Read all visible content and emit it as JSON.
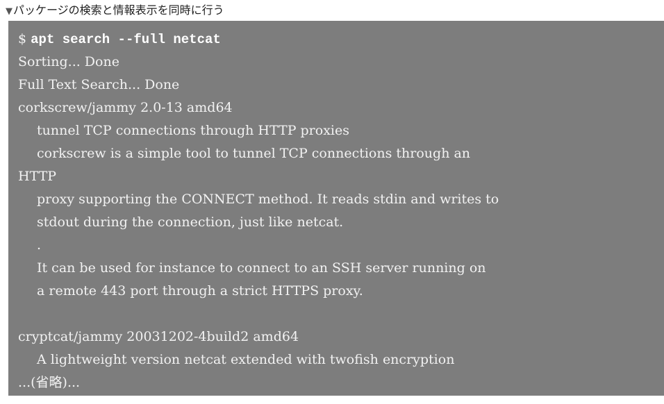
{
  "caption": {
    "icon": "triangle-down-icon",
    "text": "パッケージの検索と情報表示を同時に行う"
  },
  "terminal": {
    "prompt": "$",
    "command": "apt search --full netcat",
    "lines": [
      "Sorting... Done",
      "Full Text Search... Done",
      "corkscrew/jammy 2.0-13 amd64",
      "tunnel TCP connections through HTTP proxies",
      "corkscrew is a simple tool to tunnel TCP connections through an",
      "HTTP",
      "proxy supporting the CONNECT method. It reads stdin and writes to",
      "stdout during the connection, just like netcat.",
      ".",
      "It can be used for instance to connect to an SSH server running on",
      "a remote 443 port through a strict HTTPS proxy.",
      "",
      "cryptcat/jammy 20031202-4build2 amd64",
      "A lightweight version netcat extended with twofish encryption",
      "...(省略)..."
    ]
  }
}
